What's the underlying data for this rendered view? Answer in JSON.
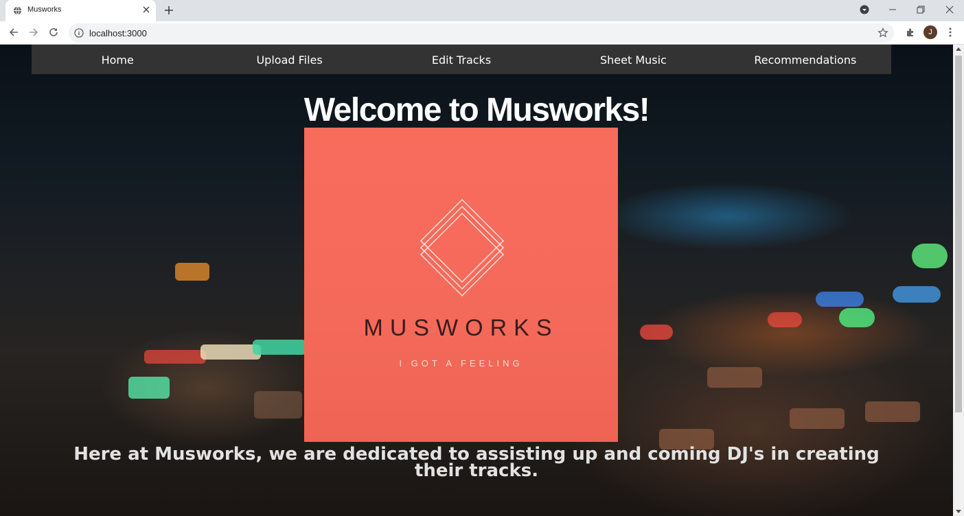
{
  "browser": {
    "tab_title": "Musworks",
    "url": "localhost:3000",
    "profile_initial": "J"
  },
  "nav": {
    "items": [
      "Home",
      "Upload Files",
      "Edit Tracks",
      "Sheet Music",
      "Recommendations"
    ]
  },
  "hero": {
    "title": "Welcome to Musworks!",
    "logo_word": "MUSWORKS",
    "logo_tagline": "I GOT A FEELING",
    "tagline": "Here at Musworks, we are dedicated to assisting up and coming DJ's in creating their tracks."
  },
  "colors": {
    "nav_bg": "#333333",
    "logo_bg": "#f86c5c",
    "logo_text": "#3a1c1c"
  },
  "icons": {
    "tab": "globe-icon",
    "close": "close-icon",
    "new_tab": "plus-icon",
    "back": "back-arrow-icon",
    "forward": "forward-arrow-icon",
    "reload": "reload-icon",
    "info": "info-icon",
    "bookmark": "star-icon",
    "extensions": "puzzle-icon",
    "menu": "kebab-menu-icon"
  }
}
